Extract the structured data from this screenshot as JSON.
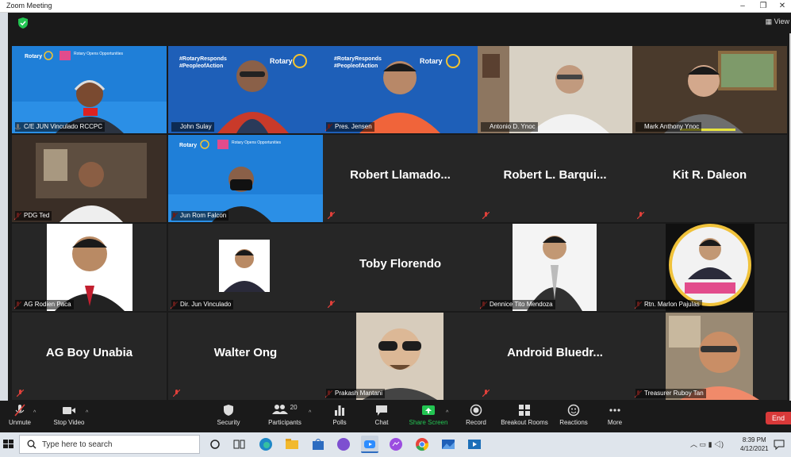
{
  "window": {
    "title": "Zoom Meeting",
    "controls": [
      "–",
      "❐",
      "✕"
    ]
  },
  "header": {
    "view_label": "View"
  },
  "participants": [
    {
      "name": "C/E JUN Vinculado RCCPC",
      "display": "video",
      "active_speaker": true,
      "muted": false
    },
    {
      "name": "John Sulay",
      "display": "video",
      "muted": false
    },
    {
      "name": "Pres. Jensen",
      "display": "video",
      "muted": true
    },
    {
      "name": "Antonio D. Ynoc",
      "display": "video",
      "muted": false
    },
    {
      "name": "Mark Anthony Ynoc",
      "display": "video",
      "muted": false
    },
    {
      "name": "PDG Ted",
      "display": "video",
      "muted": true
    },
    {
      "name": "Jun Rom Falcon",
      "display": "video",
      "muted": true
    },
    {
      "name": "Robert  Llamado...",
      "display": "name",
      "muted": true
    },
    {
      "name": "Robert  L.  Barqui...",
      "display": "name",
      "muted": true
    },
    {
      "name": "Kit R. Daleon",
      "display": "name",
      "muted": true
    },
    {
      "name": "AG Rodien Paca",
      "display": "photo",
      "muted": true
    },
    {
      "name": "Dir. Jun Vinculado",
      "display": "photo",
      "muted": true
    },
    {
      "name": "Toby Florendo",
      "display": "name",
      "muted": true
    },
    {
      "name": "Dennice Tito Mendoza",
      "display": "photo",
      "muted": true
    },
    {
      "name": "Rtn. Marlon Pajulas",
      "display": "photo",
      "muted": true
    },
    {
      "name": "AG Boy Unabia",
      "display": "name",
      "muted": true
    },
    {
      "name": "Walter Ong",
      "display": "name",
      "muted": true
    },
    {
      "name": "Prakash Mantani",
      "display": "video",
      "muted": true
    },
    {
      "name": "Android  Bluedr...",
      "display": "name",
      "muted": true
    },
    {
      "name": "Treasurer Ruboy Tan",
      "display": "photo",
      "muted": true
    }
  ],
  "backgrounds": {
    "rotary_text_1": "Rotary",
    "rotary_text_2": "Rotary Opens Opportunities",
    "hashtag_1": "#RotaryResponds",
    "hashtag_2": "#PeopleofAction"
  },
  "toolbar": {
    "unmute": "Unmute",
    "stop_video": "Stop Video",
    "security": "Security",
    "participants": "Participants",
    "participants_count": "20",
    "polls": "Polls",
    "chat": "Chat",
    "share_screen": "Share Screen",
    "record": "Record",
    "breakout_rooms": "Breakout Rooms",
    "reactions": "Reactions",
    "more": "More",
    "end": "End"
  },
  "taskbar": {
    "search_placeholder": "Type here to search",
    "time": "8:39 PM",
    "date": "4/12/2021"
  },
  "colors": {
    "accent_yellow": "#e7e33e",
    "share_green": "#23c552",
    "end_red": "#d93939",
    "mute_red": "#e0403a",
    "rotary_blue": "#1a6fd0"
  }
}
